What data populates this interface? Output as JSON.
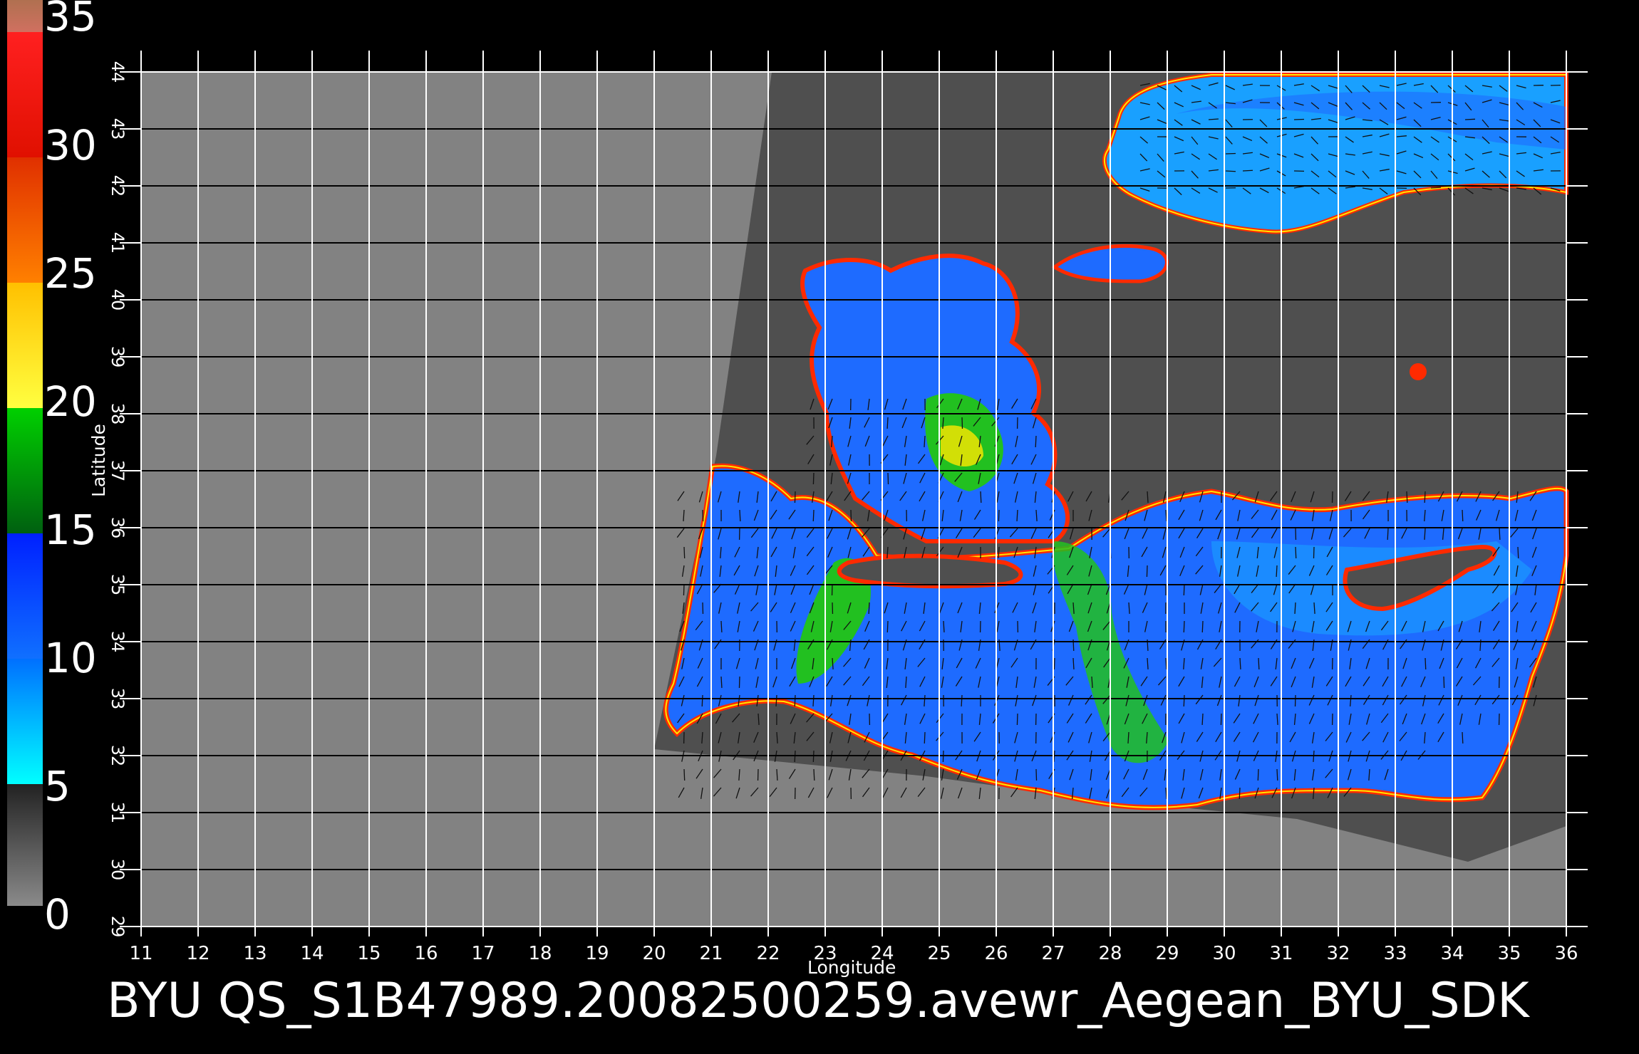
{
  "footer": {
    "title": "BYU  QS_S1B47989.20082500259.avewr_Aegean_BYU_SDK"
  },
  "axes": {
    "xlabel": "Longitude",
    "ylabel": "Latitude",
    "lon_ticks": [
      "11",
      "12",
      "13",
      "14",
      "15",
      "16",
      "17",
      "18",
      "19",
      "20",
      "21",
      "22",
      "23",
      "24",
      "25",
      "26",
      "27",
      "28",
      "29",
      "30",
      "31",
      "32",
      "33",
      "34",
      "35",
      "36"
    ],
    "lat_ticks": [
      "29",
      "30",
      "31",
      "32",
      "33",
      "34",
      "35",
      "36",
      "37",
      "38",
      "39",
      "40",
      "41",
      "42",
      "43",
      "44"
    ]
  },
  "colorbar": {
    "labels": [
      "0",
      "5",
      "10",
      "15",
      "20",
      "25",
      "30",
      "35"
    ],
    "colors": {
      "gray": "#808080",
      "cyan": "#00ffff",
      "blue": "#0050ff",
      "green": "#00c000",
      "yellow": "#ffff00",
      "orange": "#ff6000",
      "red": "#ff0000",
      "brown": "#c08060"
    }
  },
  "map": {
    "lon_range": [
      11,
      36
    ],
    "lat_range": [
      29,
      44
    ],
    "colors": {
      "background_gray": "#828282",
      "swath_dark": "#4f4f4f",
      "ocean_blue": "#1e6bff",
      "ocean_light": "#19a0ff",
      "ocean_green": "#22c020",
      "coast_red": "#ff2a00",
      "coast_yellow": "#ffe600",
      "grid": "#000000"
    }
  }
}
